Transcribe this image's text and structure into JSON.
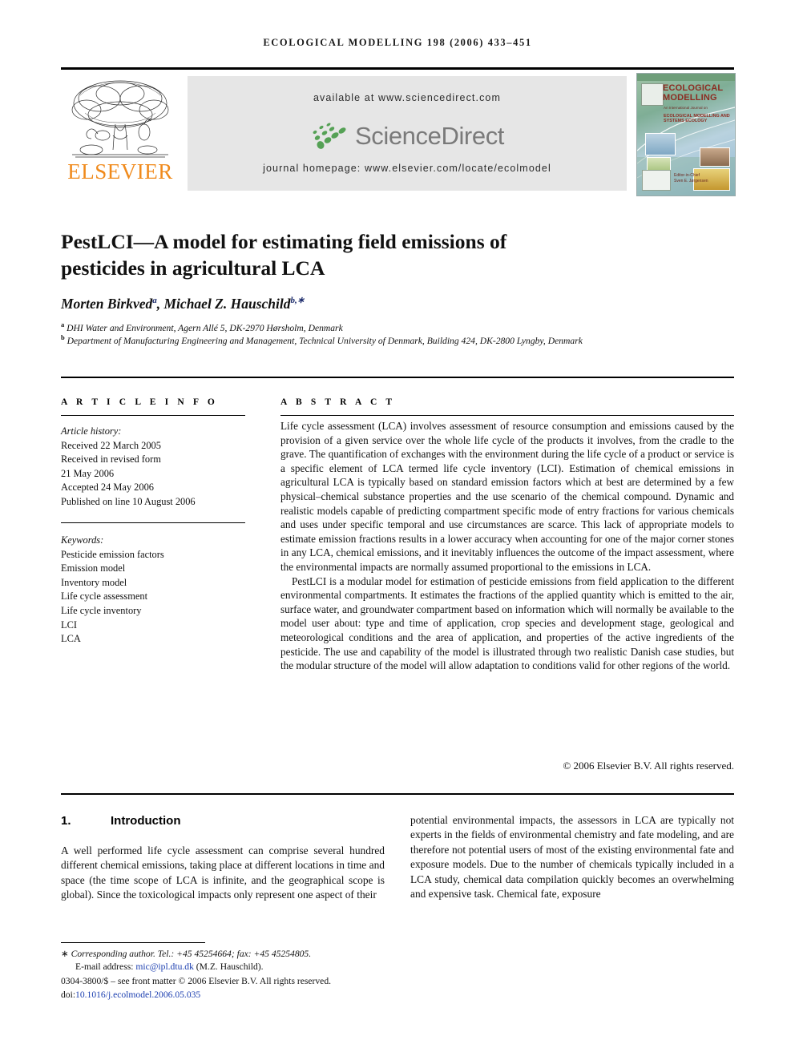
{
  "running_head": "ECOLOGICAL MODELLING 198 (2006) 433–451",
  "masthead": {
    "publisher_name": "ELSEVIER",
    "available_at": "available at www.sciencedirect.com",
    "sciencedirect_logo_text": "ScienceDirect",
    "journal_homepage": "journal homepage: www.elsevier.com/locate/ecolmodel",
    "cover": {
      "title_line1": "ECOLOGICAL",
      "title_line2": "MODELLING",
      "subtitle": "An International Journal on",
      "scope_line1": "ECOLOGICAL MODELLING AND",
      "scope_line2": "SYSTEMS ECOLOGY",
      "editor_label": "Editor-in-Chief",
      "editor_name": "Sven E. Jørgensen"
    }
  },
  "article": {
    "title": "PestLCI—A model for estimating field emissions of pesticides in agricultural LCA",
    "authors_html": "Morten Birkved<sup>a</sup>, Michael Z. Hauschild<sup>b,</sup><sup>∗</sup>",
    "affiliation_a": "DHI Water and Environment, Agern Allé 5, DK-2970 Hørsholm, Denmark",
    "affiliation_b": "Department of Manufacturing Engineering and Management, Technical University of Denmark, Building 424, DK-2800 Lyngby, Denmark"
  },
  "article_info": {
    "heading": "A R T I C L E  I N F O",
    "history_label": "Article history:",
    "history": [
      "Received 22 March 2005",
      "Received in revised form",
      "21 May 2006",
      "Accepted 24 May 2006",
      "Published on line 10 August 2006"
    ],
    "keywords_label": "Keywords:",
    "keywords": [
      "Pesticide emission factors",
      "Emission model",
      "Inventory model",
      "Life cycle assessment",
      "Life cycle inventory",
      "LCI",
      "LCA"
    ]
  },
  "abstract": {
    "heading": "A B S T R A C T",
    "paragraph1": "Life cycle assessment (LCA) involves assessment of resource consumption and emissions caused by the provision of a given service over the whole life cycle of the products it involves, from the cradle to the grave. The quantification of exchanges with the environment during the life cycle of a product or service is a specific element of LCA termed life cycle inventory (LCI). Estimation of chemical emissions in agricultural LCA is typically based on standard emission factors which at best are determined by a few physical–chemical substance properties and the use scenario of the chemical compound. Dynamic and realistic models capable of predicting compartment specific mode of entry fractions for various chemicals and uses under specific temporal and use circumstances are scarce. This lack of appropriate models to estimate emission fractions results in a lower accuracy when accounting for one of the major corner stones in any LCA, chemical emissions, and it inevitably influences the outcome of the impact assessment, where the environmental impacts are normally assumed proportional to the emissions in LCA.",
    "paragraph2": "PestLCI is a modular model for estimation of pesticide emissions from field application to the different environmental compartments. It estimates the fractions of the applied quantity which is emitted to the air, surface water, and groundwater compartment based on information which will normally be available to the model user about: type and time of application, crop species and development stage, geological and meteorological conditions and the area of application, and properties of the active ingredients of the pesticide. The use and capability of the model is illustrated through two realistic Danish case studies, but the modular structure of the model will allow adaptation to conditions valid for other regions of the world.",
    "copyright": "© 2006 Elsevier B.V. All rights reserved."
  },
  "body": {
    "section_number": "1.",
    "section_title": "Introduction",
    "left_column": "A well performed life cycle assessment can comprise several hundred different chemical emissions, taking place at different locations in time and space (the time scope of LCA is infinite, and the geographical scope is global). Since the toxicological impacts only represent one aspect of their",
    "right_column": "potential environmental impacts, the assessors in LCA are typically not experts in the fields of environmental chemistry and fate modeling, and are therefore not potential users of most of the existing environmental fate and exposure models. Due to the number of chemicals typically included in a LCA study, chemical data compilation quickly becomes an overwhelming and  expensive task. Chemical fate, exposure"
  },
  "footnotes": {
    "corresponding": "Corresponding author. Tel.: +45 45254664; fax: +45 45254805.",
    "email_label": "E-mail address:",
    "email_link": "mic@ipl.dtu.dk",
    "email_suffix": "(M.Z. Hauschild).",
    "issn_line": "0304-3800/$ – see front matter © 2006 Elsevier B.V. All rights reserved.",
    "doi_label": "doi:",
    "doi_value": "10.1016/j.ecolmodel.2006.05.035"
  },
  "colors": {
    "elsevier_orange": "#f08a1c",
    "link_blue": "#1c3fb0",
    "banner_gray": "#e6e6e6",
    "sciencedirect_green": "#55a155",
    "cover_red": "#8c2c22"
  }
}
